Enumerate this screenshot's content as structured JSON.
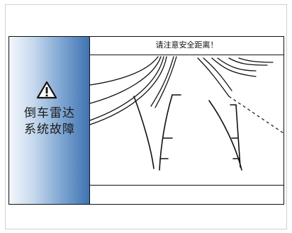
{
  "warning": {
    "icon": "warning-triangle-icon",
    "line1": "倒车雷达",
    "line2": "系统故障"
  },
  "camera": {
    "banner_text": "请注意安全距离！"
  },
  "colors": {
    "panel_gradient_start": "#f3f7fc",
    "panel_gradient_end": "#3f73b2",
    "line": "#111111"
  }
}
